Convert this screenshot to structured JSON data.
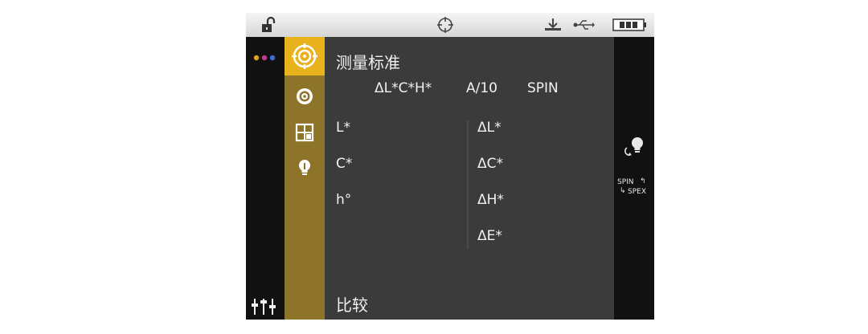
{
  "header": {
    "title": "测量标准"
  },
  "settings": {
    "color_scale": "ΔL*C*H*",
    "illuminant": "A/10",
    "mode": "SPIN"
  },
  "left_labels": [
    "L*",
    "C*",
    "h°"
  ],
  "delta_labels": [
    "ΔL*",
    "ΔC*",
    "ΔH*",
    "ΔE*"
  ],
  "footer": {
    "label": "比较"
  },
  "side": {
    "spin": "SPIN",
    "spex": "SPEX"
  },
  "colors": {
    "gold": "#e8b21c",
    "gold_dark": "#8e7428",
    "panel": "#3b3b3b"
  },
  "icons": {
    "status": [
      "unlock-icon",
      "target-icon",
      "download-icon",
      "usb-icon",
      "battery-icon"
    ],
    "tabs": [
      "target-icon",
      "circle-target-icon",
      "grid-icon",
      "lightbulb-icon"
    ],
    "left": [
      "dots-menu-icon",
      "sliders-icon"
    ],
    "right": [
      "lightbulb-rotate-icon",
      "spin-spex-toggle-icon"
    ]
  }
}
